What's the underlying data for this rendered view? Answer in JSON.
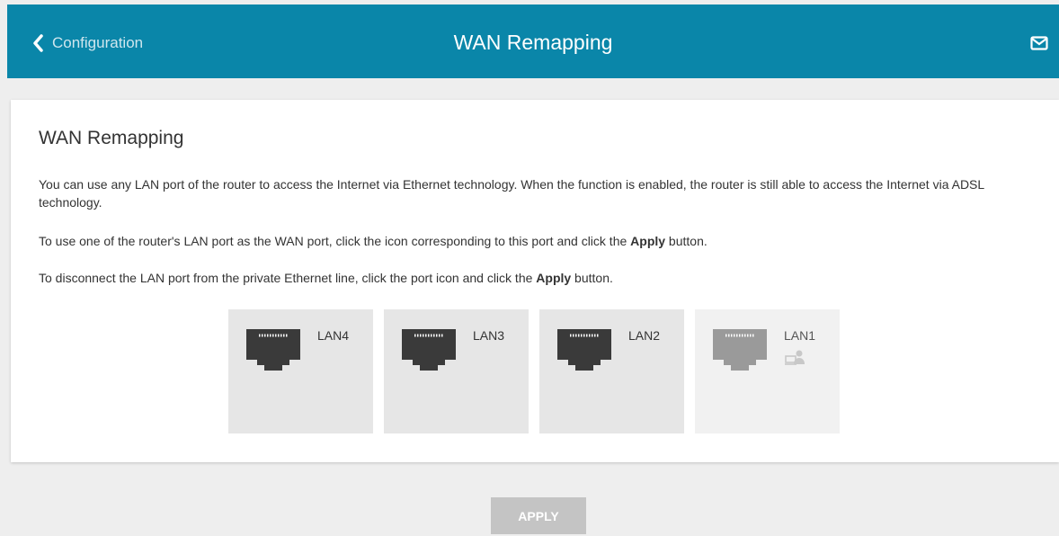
{
  "header": {
    "back_label": "Configuration",
    "title": "WAN Remapping",
    "bg_color": "#0a86a9",
    "icons": [
      "chevron-left-icon",
      "mail-icon"
    ]
  },
  "content": {
    "heading": "WAN Remapping",
    "paragraph1": "You can use any LAN port of the router to access the Internet via Ethernet technology. When the function is enabled, the router is still able to access the Internet via ADSL technology.",
    "paragraph2_pre": "To use one of the router's LAN port as the WAN port, click the icon corresponding to this port and click the ",
    "paragraph2_bold": "Apply",
    "paragraph2_post": " button.",
    "paragraph3_pre": "To disconnect the LAN port from the private Ethernet line, click the port icon and click the ",
    "paragraph3_bold": "Apply",
    "paragraph3_post": " button."
  },
  "ports": [
    {
      "label": "LAN4",
      "state": "available"
    },
    {
      "label": "LAN3",
      "state": "available"
    },
    {
      "label": "LAN2",
      "state": "available"
    },
    {
      "label": "LAN1",
      "state": "in-use",
      "status_icon": "pc-user-icon"
    }
  ],
  "actions": {
    "apply_label": "APPLY",
    "apply_enabled": false
  }
}
